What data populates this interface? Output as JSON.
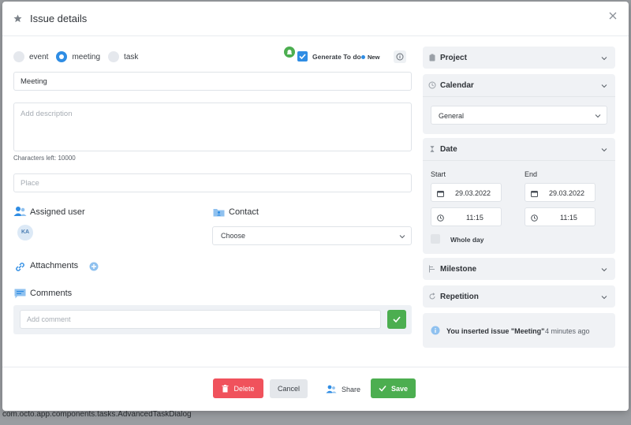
{
  "dialog": {
    "title": "Issue details"
  },
  "type_options": [
    {
      "label": "event",
      "selected": false
    },
    {
      "label": "meeting",
      "selected": true
    },
    {
      "label": "task",
      "selected": false
    }
  ],
  "generate_todo": {
    "label": "Generate To do",
    "checked": true,
    "badge": "New"
  },
  "form": {
    "title_value": "Meeting",
    "description_placeholder": "Add description",
    "characters_left": "Characters left: 10000",
    "place_placeholder": "Place"
  },
  "assigned_user": {
    "heading": "Assigned user",
    "initials": "KA"
  },
  "contact": {
    "heading": "Contact",
    "select_value": "Choose"
  },
  "attachments": {
    "heading": "Attachments"
  },
  "comments": {
    "heading": "Comments",
    "placeholder": "Add comment"
  },
  "sidebar": {
    "project": {
      "title": "Project"
    },
    "calendar": {
      "title": "Calendar",
      "value": "General"
    },
    "date": {
      "title": "Date",
      "start_label": "Start",
      "end_label": "End",
      "start_date": "29.03.2022",
      "start_time": "11:15",
      "end_date": "29.03.2022",
      "end_time": "11:15",
      "whole_day_label": "Whole day"
    },
    "milestone": {
      "title": "Milestone"
    },
    "repetition": {
      "title": "Repetition"
    },
    "activity": {
      "text": "You inserted issue \"Meeting\"",
      "time": "4 minutes ago"
    }
  },
  "footer": {
    "delete_label": "Delete",
    "cancel_label": "Cancel",
    "share_label": "Share",
    "save_label": "Save"
  },
  "background": {
    "status_text": "com.octo.app.components.tasks.AdvancedTaskDialog"
  },
  "colors": {
    "accent": "#2f8de4",
    "success": "#4cae50",
    "danger": "#f0525c"
  }
}
